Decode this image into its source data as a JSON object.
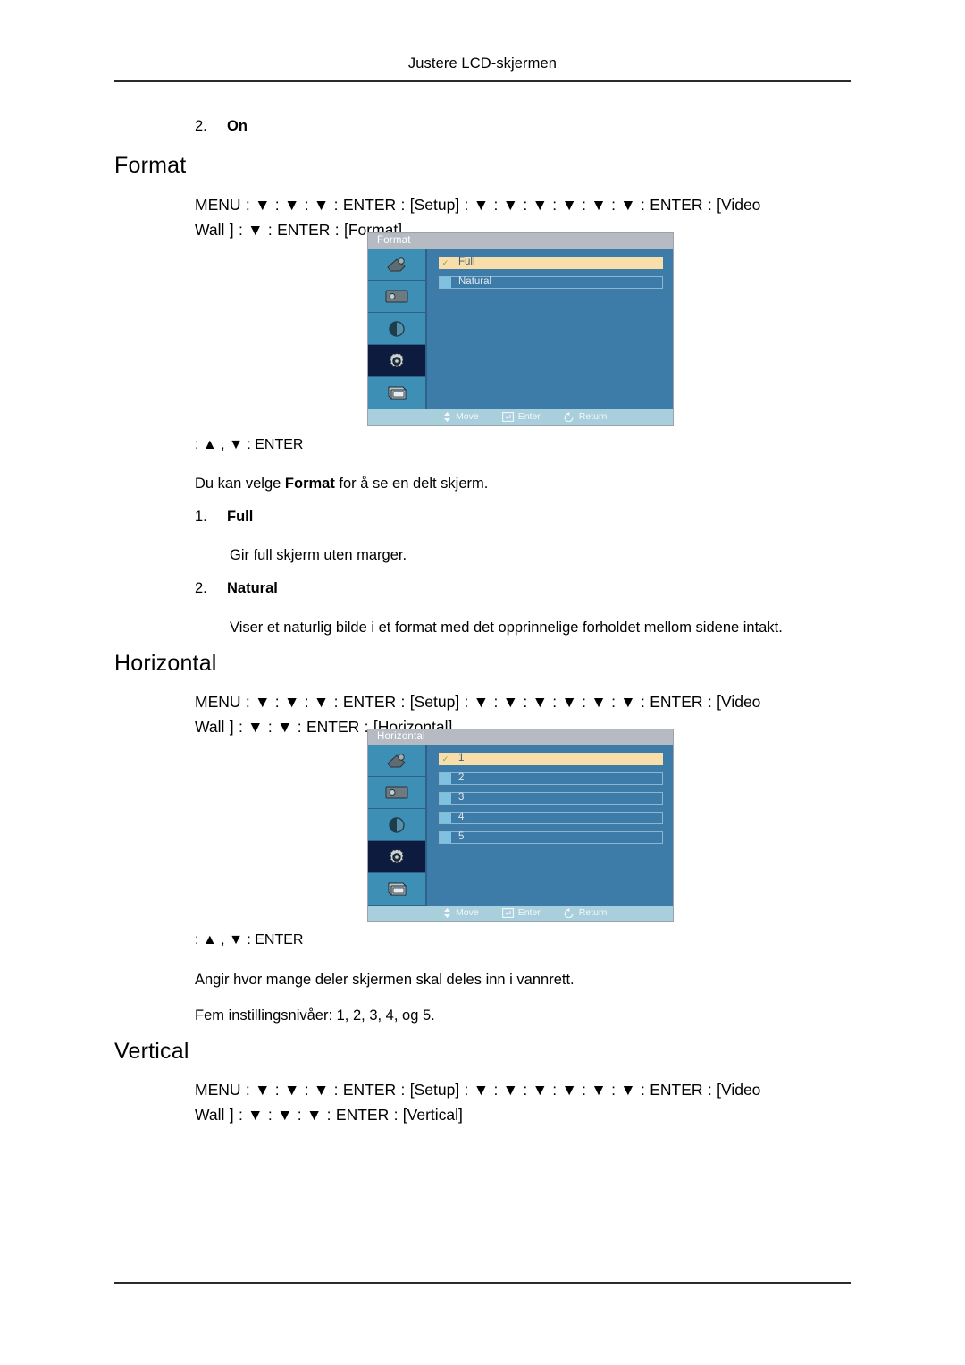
{
  "document": {
    "running_header": "Justere LCD-skjermen"
  },
  "intro_item": {
    "number": "2.",
    "label": "On"
  },
  "sections": [
    {
      "heading": "Format",
      "path_line1": "MENU  :  ▼  :  ▼  :  ▼  :   ENTER  :  [Setup]  :  ▼ :  ▼ :  ▼ :  ▼  :  ▼  :  ▼  :  ENTER  :  [Video",
      "path_line2": "Wall ] :   ▼  :  ENTER  : [Format]",
      "keyline": ":  ▲ , ▼  : ENTER",
      "description_prefix": "Du kan velge ",
      "description_bold": "Format",
      "description_suffix": " for å se en delt skjerm.",
      "items": [
        {
          "number": "1.",
          "label": "Full",
          "text": "Gir full skjerm uten marger."
        },
        {
          "number": "2.",
          "label": "Natural",
          "text": "Viser et naturlig bilde i et format med det opprinnelige forholdet mellom sidene intakt."
        }
      ],
      "osd": {
        "title": "Format",
        "options": [
          {
            "label": "Full",
            "selected": true
          },
          {
            "label": "Natural",
            "selected": false
          }
        ],
        "footer": [
          {
            "icon": "updown-arrow-icon",
            "label": "Move"
          },
          {
            "icon": "enter-key-icon",
            "label": "Enter"
          },
          {
            "icon": "return-arrow-icon",
            "label": "Return"
          }
        ],
        "rail_icons": [
          "picture-icon",
          "screen-icon",
          "contrast-icon",
          "setup-gear-icon",
          "multi-display-icon"
        ],
        "selected_rail_index": 3
      }
    },
    {
      "heading": "Horizontal",
      "path_line1": "MENU  :  ▼  :  ▼  :  ▼  :   ENTER  :  [Setup]  :  ▼ :  ▼ :  ▼ :  ▼  :  ▼  :  ▼  :  ENTER  :  [Video",
      "path_line2": "Wall ] :   ▼  :  ▼  :  ENTER  : [Horizontal]",
      "keyline": ":  ▲ , ▼  : ENTER",
      "paragraphs": [
        "Angir hvor mange deler skjermen skal deles inn i vannrett.",
        "Fem instillingsnivåer: 1, 2, 3, 4, og 5."
      ],
      "osd": {
        "title": "Horizontal",
        "options": [
          {
            "label": "1",
            "selected": true
          },
          {
            "label": "2",
            "selected": false
          },
          {
            "label": "3",
            "selected": false
          },
          {
            "label": "4",
            "selected": false
          },
          {
            "label": "5",
            "selected": false
          }
        ],
        "footer": [
          {
            "icon": "updown-arrow-icon",
            "label": "Move"
          },
          {
            "icon": "enter-key-icon",
            "label": "Enter"
          },
          {
            "icon": "return-arrow-icon",
            "label": "Return"
          }
        ],
        "rail_icons": [
          "picture-icon",
          "screen-icon",
          "contrast-icon",
          "setup-gear-icon",
          "multi-display-icon"
        ],
        "selected_rail_index": 3
      }
    },
    {
      "heading": "Vertical",
      "path_line1": "MENU  :  ▼  :  ▼  :  ▼  :   ENTER  :  [Setup]  :  ▼ :  ▼ :  ▼ :  ▼  :  ▼  :  ▼  :  ENTER  :  [Video",
      "path_line2": "Wall ] :   ▼  :  ▼  :  ▼  :  ENTER  : [Vertical]"
    }
  ],
  "colors": {
    "osd_background": "#3d7ba8",
    "osd_title_bar": "#b6bac2",
    "osd_selected_row": "#f8dfaa",
    "osd_footer_bar": "#a9cfdd",
    "rail_tile": "#3d8fb5",
    "rail_tile_selected": "#0d1b3e"
  }
}
